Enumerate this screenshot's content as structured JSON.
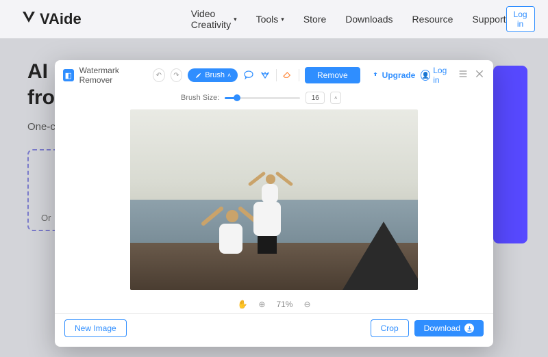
{
  "site": {
    "brand": "VAide",
    "nav": {
      "creativity": "Video Creativity",
      "tools": "Tools",
      "store": "Store",
      "downloads": "Downloads",
      "resource": "Resource",
      "support": "Support"
    },
    "login": "Log in"
  },
  "hero": {
    "title_l1": "AI F",
    "title_l2": "from",
    "subtitle": "One-c\nphoto",
    "dropzone_hint": "Or"
  },
  "modal": {
    "app_title": "Watermark Remover",
    "brush_label": "Brush",
    "brush_size_label": "Brush Size:",
    "brush_size_value": "16",
    "remove": "Remove",
    "upgrade": "Upgrade",
    "login": "Log in",
    "zoom_value": "71%",
    "new_image": "New Image",
    "crop": "Crop",
    "download": "Download"
  }
}
